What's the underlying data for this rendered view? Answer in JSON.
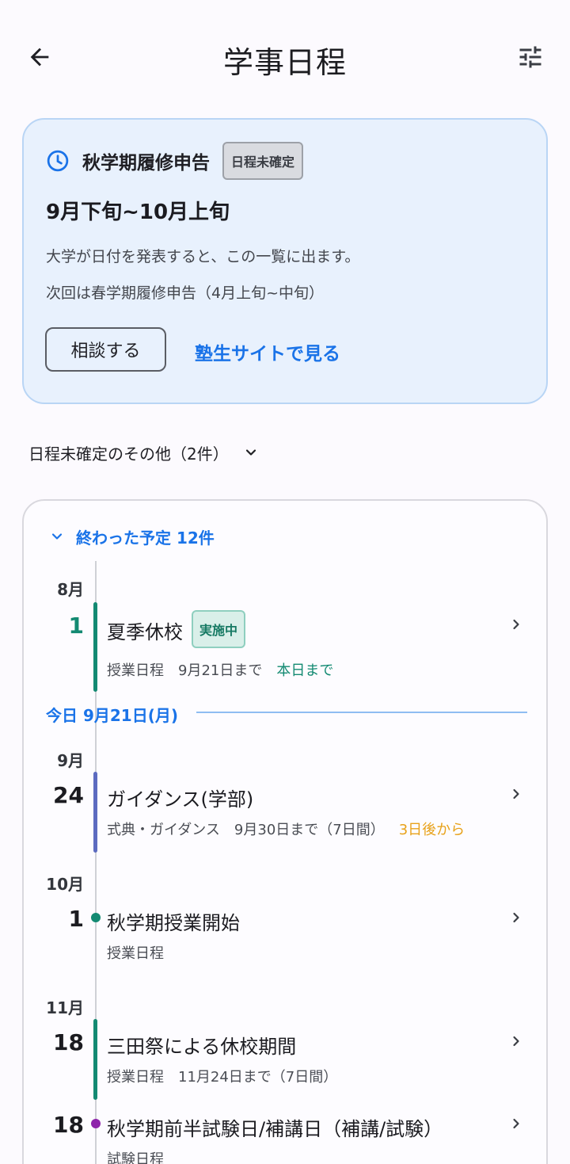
{
  "header": {
    "title": "学事日程",
    "back_icon": "arrow-left-icon",
    "filter_icon": "tune-icon"
  },
  "highlight": {
    "icon": "clock-icon",
    "title": "秋学期履修申告",
    "badge": "日程未確定",
    "period": "9月下旬~10月上旬",
    "description": "大学が日付を発表すると、この一覧に出ます。",
    "next": "次回は春学期履修申告（4月上旬~中旬）",
    "consult_button": "相談する",
    "site_link": "塾生サイトで見る"
  },
  "other_undetermined": {
    "label": "日程未確定のその他（2件）"
  },
  "schedule": {
    "past_toggle": "終わった予定 12件",
    "today_label": "今日 9月21日(月)",
    "events": [
      {
        "month": "8月",
        "day": "1",
        "title": "夏季休校",
        "status_badge": "実施中",
        "category": "授業日程",
        "until": "9月21日まで",
        "relative": "本日まで"
      },
      {
        "month": "9月",
        "day": "24",
        "title": "ガイダンス(学部)",
        "category": "式典・ガイダンス",
        "until": "9月30日まで（7日間）",
        "relative": "3日後から"
      },
      {
        "month": "10月",
        "day": "1",
        "title": "秋学期授業開始",
        "category": "授業日程"
      },
      {
        "month": "11月",
        "day": "18",
        "title": "三田祭による休校期間",
        "category": "授業日程",
        "until": "11月24日まで（7日間）"
      },
      {
        "day": "18",
        "title": "秋学期前半試験日/補講日（補講/試験）",
        "category": "試験日程"
      }
    ]
  },
  "colors": {
    "accent_blue": "#1a73e8",
    "teal": "#138a72",
    "indigo": "#5c6bc0",
    "amber": "#e8a21a",
    "purple": "#8e24aa"
  }
}
